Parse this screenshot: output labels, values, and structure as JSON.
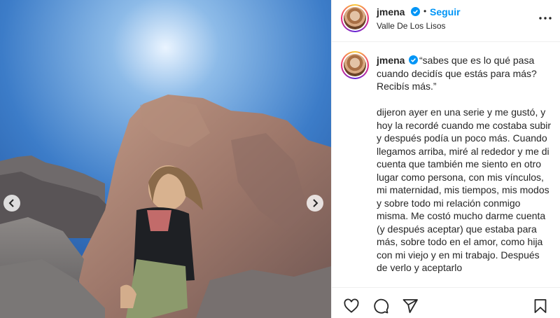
{
  "post": {
    "username": "jmena",
    "follow_label": "Seguir",
    "separator": "•",
    "location": "Valle De Los Lisos",
    "caption_text": "“sabes que es lo qué pasa cuando decidís que estás para más? Recibís más.”\n\ndijeron ayer en una serie y me gustó, y hoy la recordé cuando me costaba subir y después podía un poco más. Cuando llegamos arriba, miré al rededor y me di cuenta que también me siento en otro lugar como persona, con mis vínculos, mi maternidad, mis tiempos, mis modos y sobre todo mi relación conmigo misma. Me costó mucho darme cuenta (y después aceptar) que estaba para más, sobre todo en el amor, como hija con mi viejo y en mi trabajo. Después de verlo y aceptarlo"
  },
  "icons": {
    "verified": "verified-badge-icon",
    "more": "more-options-icon",
    "prev": "chevron-left-icon",
    "next": "chevron-right-icon",
    "like": "heart-icon",
    "comment": "comment-icon",
    "share": "share-icon",
    "save": "bookmark-icon"
  },
  "colors": {
    "link": "#0095f6",
    "verified": "#0095f6",
    "text": "#262626",
    "border": "#efefef",
    "sky": "#3b76c4"
  }
}
